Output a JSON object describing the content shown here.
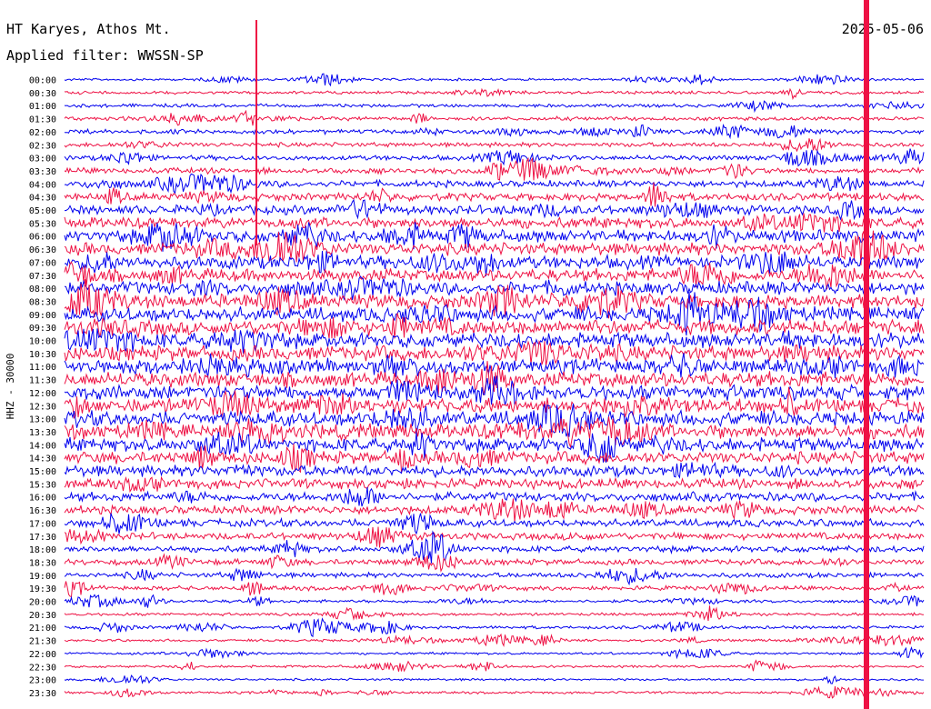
{
  "header": {
    "station": "HT Karyes, Athos Mt.",
    "filter": "Applied filter: WWSSN-SP",
    "date": "2025-05-06"
  },
  "axis": {
    "label": "HHZ - 30000"
  },
  "chart_data": {
    "type": "helicorder",
    "title": "HT Karyes, Athos Mt.",
    "subtitle": "Applied filter: WWSSN-SP",
    "date": "2025-05-06",
    "ylabel": "HHZ - 30000",
    "row_labels": [
      "00:00",
      "00:30",
      "01:00",
      "01:30",
      "02:00",
      "02:30",
      "03:00",
      "03:30",
      "04:00",
      "04:30",
      "05:00",
      "05:30",
      "06:00",
      "06:30",
      "07:00",
      "07:30",
      "08:00",
      "08:30",
      "09:00",
      "09:30",
      "10:00",
      "10:30",
      "11:00",
      "11:30",
      "12:00",
      "12:30",
      "13:00",
      "13:30",
      "14:00",
      "14:30",
      "15:00",
      "15:30",
      "16:00",
      "16:30",
      "17:00",
      "17:30",
      "18:00",
      "18:30",
      "19:00",
      "19:30",
      "20:00",
      "20:30",
      "21:00",
      "21:30",
      "22:00",
      "22:30",
      "23:00",
      "23:30"
    ],
    "row_minutes": 30,
    "colors": [
      "#0000ee",
      "#ee1144"
    ],
    "activity_levels": [
      0.04,
      0.1,
      0.12,
      0.16,
      0.2,
      0.2,
      0.24,
      0.3,
      0.36,
      0.45,
      0.55,
      0.7,
      0.8,
      0.8,
      0.85,
      0.8,
      0.85,
      0.95,
      1.0,
      1.0,
      1.0,
      1.0,
      1.0,
      1.0,
      1.0,
      1.0,
      1.0,
      1.0,
      0.9,
      0.8,
      0.7,
      0.62,
      0.55,
      0.5,
      0.45,
      0.4,
      0.35,
      0.3,
      0.24,
      0.2,
      0.1,
      0.08,
      0.1,
      0.05,
      0.04,
      0.04,
      0.03,
      0.04
    ]
  }
}
